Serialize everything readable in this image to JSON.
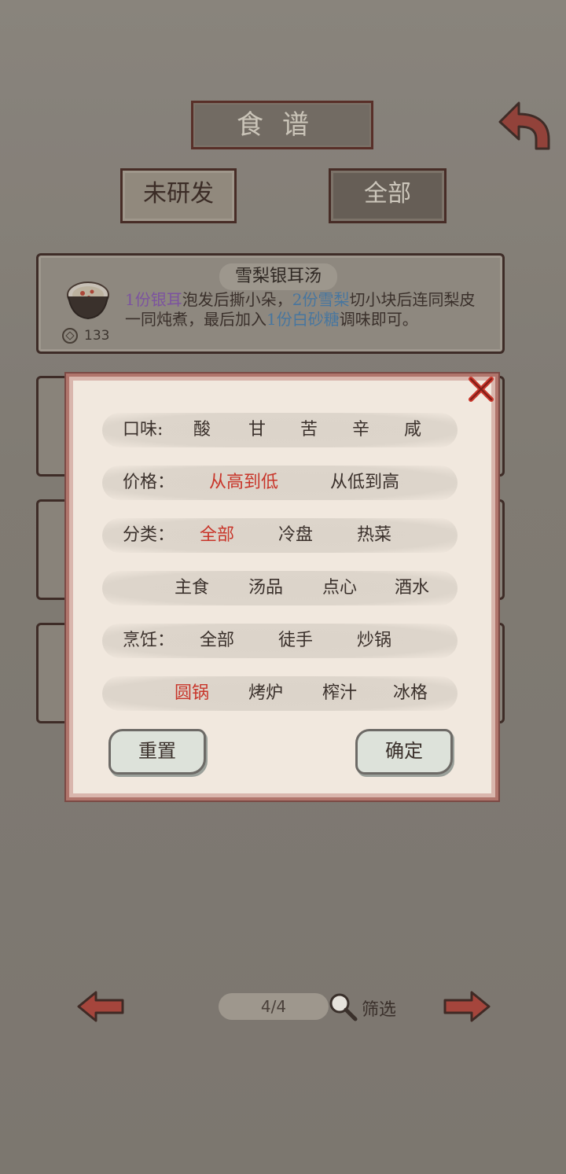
{
  "header": {
    "title": "食谱"
  },
  "tabs": {
    "undeveloped": "未研发",
    "all": "全部"
  },
  "recipe": {
    "name": "雪梨银耳汤",
    "price": "133",
    "desc_parts": [
      {
        "text": "1份银耳",
        "style": "purple"
      },
      {
        "text": "泡发后撕小朵，",
        "style": "plain"
      },
      {
        "text": "2份雪梨",
        "style": "blue"
      },
      {
        "text": "切小块后连同梨皮一同炖煮，最后加入",
        "style": "plain"
      },
      {
        "text": "1份白砂糖",
        "style": "blue"
      },
      {
        "text": "调味即可。",
        "style": "plain"
      }
    ]
  },
  "filter": {
    "taste": {
      "label": "口味:",
      "options": [
        "酸",
        "甘",
        "苦",
        "辛",
        "咸"
      ]
    },
    "price": {
      "label": "价格：",
      "options": [
        "从高到低",
        "从低到高"
      ],
      "selected": "从高到低"
    },
    "category": {
      "label": "分类：",
      "options": [
        "全部",
        "冷盘",
        "热菜",
        "主食",
        "汤品",
        "点心",
        "酒水"
      ],
      "selected": "全部"
    },
    "cooking": {
      "label": "烹饪：",
      "options": [
        "全部",
        "徒手",
        "炒锅",
        "圆锅",
        "烤炉",
        "榨汁",
        "冰格"
      ],
      "selected": "圆锅"
    },
    "reset": "重置",
    "confirm": "确定"
  },
  "footer": {
    "page": "4/4",
    "filter_label": "筛选"
  },
  "colors": {
    "selected": "#c8352a",
    "purple": "#8a5ab8",
    "blue": "#4a84b8"
  }
}
